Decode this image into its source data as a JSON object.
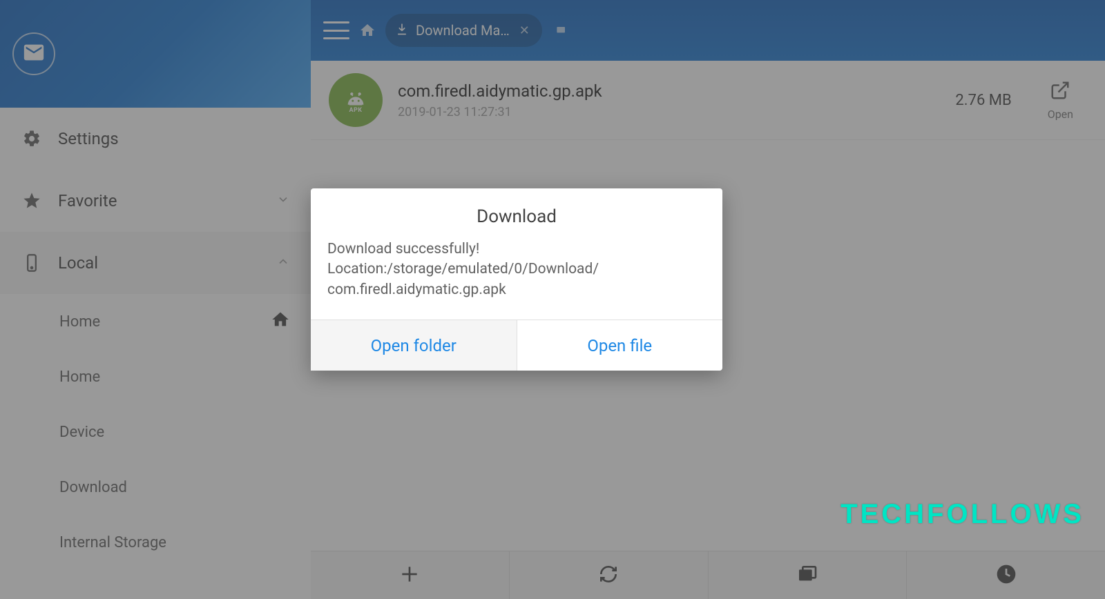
{
  "sidebar": {
    "items": [
      {
        "label": "Settings"
      },
      {
        "label": "Favorite"
      },
      {
        "label": "Local"
      }
    ],
    "subitems": [
      {
        "label": "Home"
      },
      {
        "label": "Home"
      },
      {
        "label": "Device"
      },
      {
        "label": "Download"
      },
      {
        "label": "Internal Storage"
      }
    ]
  },
  "topbar": {
    "tab_label": "Download Ma…"
  },
  "file": {
    "apk_badge": "APK",
    "name": "com.firedl.aidymatic.gp.apk",
    "date": "2019-01-23 11:27:31",
    "size": "2.76 MB",
    "open_label": "Open"
  },
  "dialog": {
    "title": "Download",
    "line1": "Download  successfully!",
    "line2": "Location:/storage/emulated/0/Download/",
    "line3": "com.firedl.aidymatic.gp.apk",
    "open_folder": "Open folder",
    "open_file": "Open file"
  },
  "watermark": "TECHFOLLOWS"
}
